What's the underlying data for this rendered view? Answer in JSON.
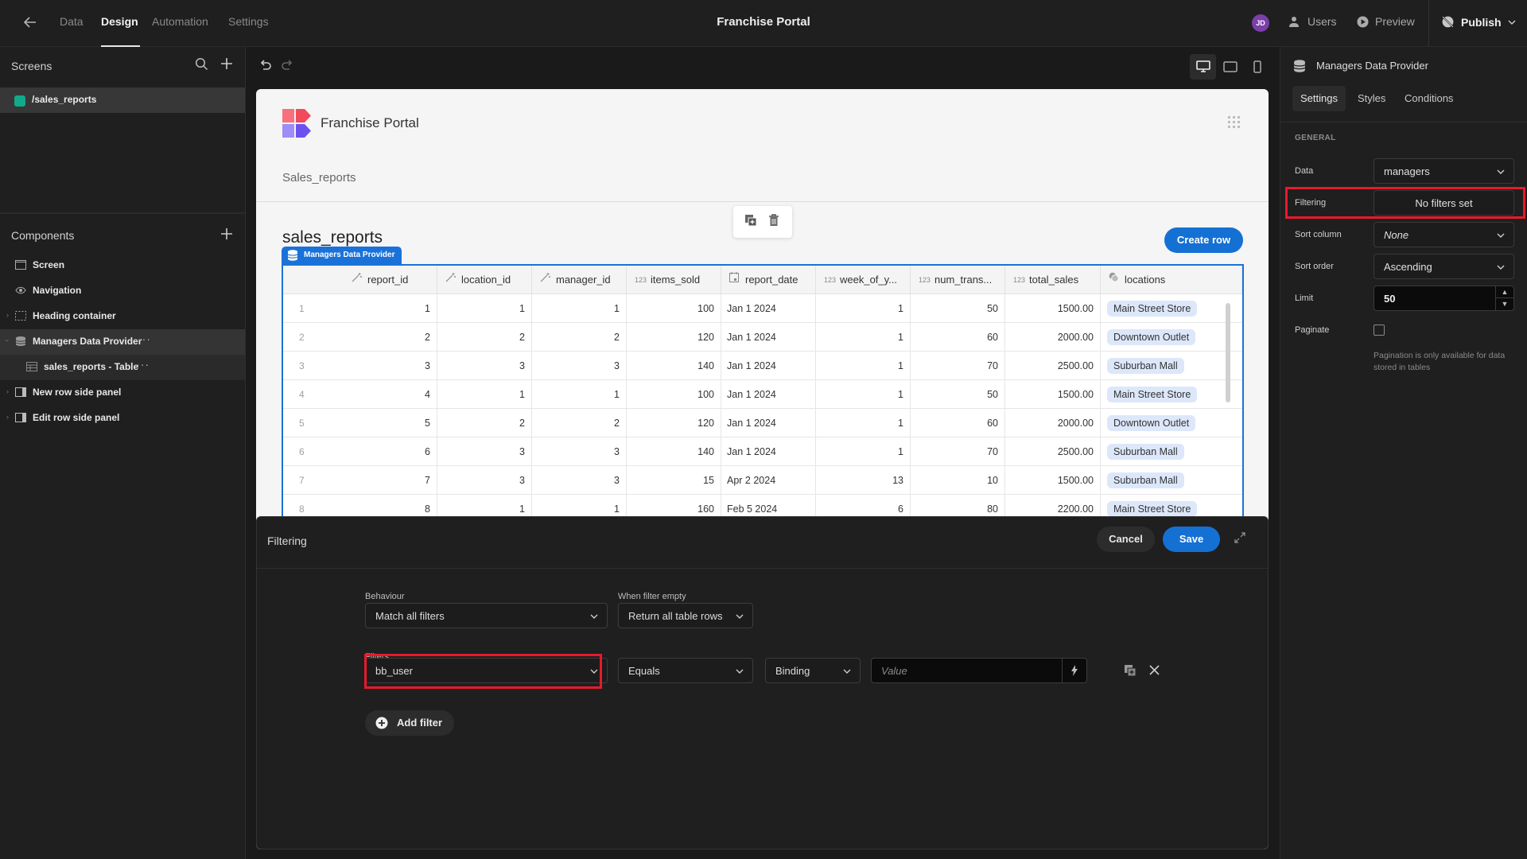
{
  "header": {
    "nav_tabs": [
      "Data",
      "Design",
      "Automation",
      "Settings"
    ],
    "active_tab": "Design",
    "app_title": "Franchise Portal",
    "avatar_initials": "JD",
    "users_label": "Users",
    "preview_label": "Preview",
    "publish_label": "Publish"
  },
  "left": {
    "screens_title": "Screens",
    "screens": [
      {
        "label": "/sales_reports",
        "color": "#11a98a"
      }
    ],
    "components_title": "Components",
    "components": [
      {
        "label": "Screen",
        "icon": "screen-icon"
      },
      {
        "label": "Navigation",
        "icon": "eye-icon"
      },
      {
        "label": "Heading container",
        "icon": "container-icon",
        "expandable": true
      },
      {
        "label": "Managers Data Provider",
        "icon": "database-icon",
        "expanded": true,
        "selected": true
      },
      {
        "label": "sales_reports - Table",
        "icon": "table-icon",
        "child": true
      },
      {
        "label": "New row side panel",
        "icon": "side-panel-icon",
        "expandable": true
      },
      {
        "label": "Edit row side panel",
        "icon": "side-panel-icon",
        "expandable": true
      }
    ]
  },
  "canvas": {
    "brand_title": "Franchise Portal",
    "page_subtitle": "Sales_reports",
    "table_title": "sales_reports",
    "create_row_label": "Create row",
    "provider_tag": "Managers Data Provider",
    "columns": [
      {
        "name": "report_id",
        "type": "autoid"
      },
      {
        "name": "location_id",
        "type": "autoid"
      },
      {
        "name": "manager_id",
        "type": "autoid"
      },
      {
        "name": "items_sold",
        "type": "number"
      },
      {
        "name": "report_date",
        "type": "date"
      },
      {
        "name": "week_of_y...",
        "type": "number"
      },
      {
        "name": "num_trans...",
        "type": "number"
      },
      {
        "name": "total_sales",
        "type": "number"
      },
      {
        "name": "locations",
        "type": "link"
      }
    ],
    "rows": [
      {
        "index": "1",
        "report_id": "1",
        "location_id": "1",
        "manager_id": "1",
        "items_sold": "100",
        "report_date": "Jan 1 2024",
        "week_of_year": "1",
        "num_transactions": "50",
        "total_sales": "1500.00",
        "locations": "Main Street Store"
      },
      {
        "index": "2",
        "report_id": "2",
        "location_id": "2",
        "manager_id": "2",
        "items_sold": "120",
        "report_date": "Jan 1 2024",
        "week_of_year": "1",
        "num_transactions": "60",
        "total_sales": "2000.00",
        "locations": "Downtown Outlet"
      },
      {
        "index": "3",
        "report_id": "3",
        "location_id": "3",
        "manager_id": "3",
        "items_sold": "140",
        "report_date": "Jan 1 2024",
        "week_of_year": "1",
        "num_transactions": "70",
        "total_sales": "2500.00",
        "locations": "Suburban Mall"
      },
      {
        "index": "4",
        "report_id": "4",
        "location_id": "1",
        "manager_id": "1",
        "items_sold": "100",
        "report_date": "Jan 1 2024",
        "week_of_year": "1",
        "num_transactions": "50",
        "total_sales": "1500.00",
        "locations": "Main Street Store"
      },
      {
        "index": "5",
        "report_id": "5",
        "location_id": "2",
        "manager_id": "2",
        "items_sold": "120",
        "report_date": "Jan 1 2024",
        "week_of_year": "1",
        "num_transactions": "60",
        "total_sales": "2000.00",
        "locations": "Downtown Outlet"
      },
      {
        "index": "6",
        "report_id": "6",
        "location_id": "3",
        "manager_id": "3",
        "items_sold": "140",
        "report_date": "Jan 1 2024",
        "week_of_year": "1",
        "num_transactions": "70",
        "total_sales": "2500.00",
        "locations": "Suburban Mall"
      },
      {
        "index": "7",
        "report_id": "7",
        "location_id": "3",
        "manager_id": "3",
        "items_sold": "15",
        "report_date": "Apr 2 2024",
        "week_of_year": "13",
        "num_transactions": "10",
        "total_sales": "1500.00",
        "locations": "Suburban Mall"
      },
      {
        "index": "8",
        "report_id": "8",
        "location_id": "1",
        "manager_id": "1",
        "items_sold": "160",
        "report_date": "Feb 5 2024",
        "week_of_year": "6",
        "num_transactions": "80",
        "total_sales": "2200.00",
        "locations": "Main Street Store"
      }
    ]
  },
  "modal": {
    "title": "Filtering",
    "cancel_label": "Cancel",
    "save_label": "Save",
    "behaviour_label": "Behaviour",
    "behaviour_value": "Match all filters",
    "when_empty_label": "When filter empty",
    "when_empty_value": "Return all table rows",
    "filters_label": "Filters",
    "filter": {
      "field": "bb_user",
      "operator": "Equals",
      "value_type": "Binding",
      "value_placeholder": "Value",
      "value": ""
    },
    "add_filter_label": "Add filter"
  },
  "right": {
    "title": "Managers Data Provider",
    "tabs": [
      "Settings",
      "Styles",
      "Conditions"
    ],
    "active_tab": "Settings",
    "section": "GENERAL",
    "data_label": "Data",
    "data_value": "managers",
    "filtering_label": "Filtering",
    "filtering_value": "No filters set",
    "sort_column_label": "Sort column",
    "sort_column_value": "None",
    "sort_order_label": "Sort order",
    "sort_order_value": "Ascending",
    "limit_label": "Limit",
    "limit_value": "50",
    "paginate_label": "Paginate",
    "paginate_checked": false,
    "paginate_hint": "Pagination is only available for data stored in tables"
  },
  "highlight_color": "#e8192c",
  "accent_color": "#1570d4"
}
